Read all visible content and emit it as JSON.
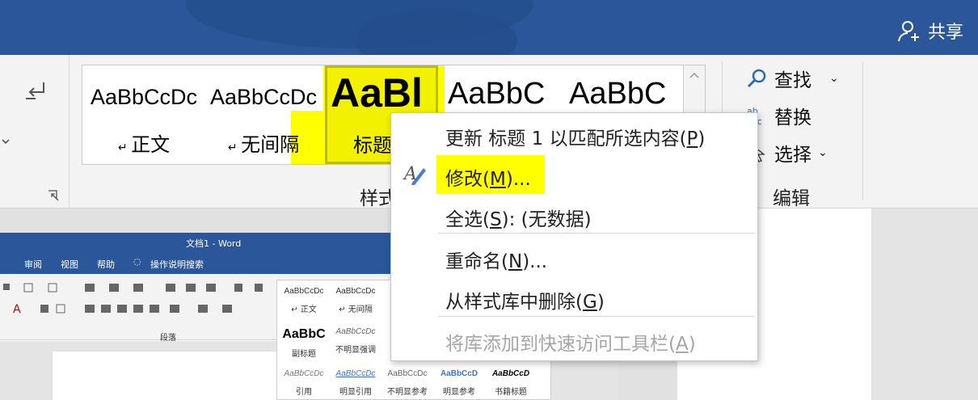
{
  "title_bar": {
    "share_label": "共享"
  },
  "ribbon": {
    "styles": [
      {
        "preview": "AaBbCcDc",
        "name": "正文"
      },
      {
        "preview": "AaBbCcDc",
        "name": "无间隔"
      },
      {
        "preview": "AaBl",
        "name": "标题"
      },
      {
        "preview": "AaBbC",
        "name": ""
      },
      {
        "preview": "AaBbC",
        "name": ""
      }
    ],
    "styles_group_label": "样式",
    "editing": {
      "find": "查找",
      "replace": "替换",
      "select": "选择",
      "group_label": "编辑"
    }
  },
  "context_menu": {
    "items": [
      {
        "text": "更新 标题 1 以匹配所选内容(",
        "key": "P",
        "suffix": ")",
        "enabled": true
      },
      {
        "text": "修改(",
        "key": "M",
        "suffix": ")...",
        "enabled": true
      },
      {
        "text": "全选(",
        "key": "S",
        "suffix": "): (无数据)",
        "enabled": true
      },
      {
        "text": "重命名(",
        "key": "N",
        "suffix": ")...",
        "enabled": true
      },
      {
        "text": "从样式库中删除(",
        "key": "G",
        "suffix": ")",
        "enabled": true
      },
      {
        "text": "将库添加到快速访问工具栏(",
        "key": "A",
        "suffix": ")",
        "enabled": false
      }
    ]
  },
  "inner_window": {
    "title": "文档1 - Word",
    "tabs": [
      "审阅",
      "视图",
      "帮助",
      "操作说明搜索"
    ],
    "group_label": "段落",
    "styles": [
      {
        "preview": "AaBbCcDc",
        "name": "↵ 正文"
      },
      {
        "preview": "AaBbCcDc",
        "name": "↵ 无间隔"
      },
      {
        "preview": "AaBbC",
        "name": "副标题"
      },
      {
        "preview": "AaBbCcDc",
        "name": "不明显强调"
      },
      {
        "preview": "AaBbCcDc",
        "name": "引用"
      },
      {
        "preview": "AaBbCcDc",
        "name": "明显引用"
      },
      {
        "preview": "AaBbCcDc",
        "name": "不明显参考"
      },
      {
        "preview": "AaBbCcD",
        "name": "明显参考"
      },
      {
        "preview": "AaBbCcD",
        "name": "书籍标题"
      }
    ]
  },
  "colors": {
    "title_blue": "#2b579a",
    "highlight": "#ffff00"
  }
}
